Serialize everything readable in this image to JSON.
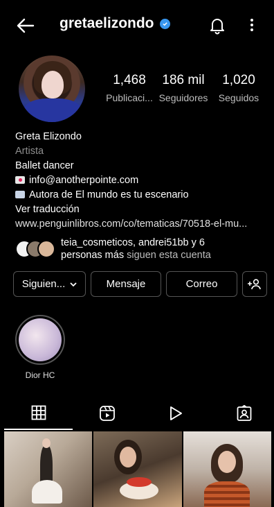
{
  "header": {
    "username": "gretaelizondo"
  },
  "profile": {
    "stats": [
      {
        "value": "1,468",
        "label": "Publicaci..."
      },
      {
        "value": "186 mil",
        "label": "Seguidores"
      },
      {
        "value": "1,020",
        "label": "Seguidos"
      }
    ],
    "name": "Greta Elizondo",
    "category": "Artista",
    "bio_line1": "Ballet dancer",
    "email": "info@anotherpointe.com",
    "book_line": "Autora de El mundo es tu escenario",
    "translate": "Ver traducción",
    "website": "www.penguinlibros.com/co/tematicas/70518-el-mu...",
    "followed_by_names": "teia_cosmeticos, andrei51bb",
    "followed_by_and": " y 6",
    "followed_by_more": "personas más",
    "followed_by_tail": " siguen esta cuenta"
  },
  "buttons": {
    "following": "Siguien...",
    "message": "Mensaje",
    "email": "Correo"
  },
  "highlights": [
    {
      "label": "Dior HC"
    }
  ],
  "colors": {
    "background": "#000000",
    "verified": "#3897f0",
    "muted": "#8e8e8e",
    "border": "#555555"
  }
}
